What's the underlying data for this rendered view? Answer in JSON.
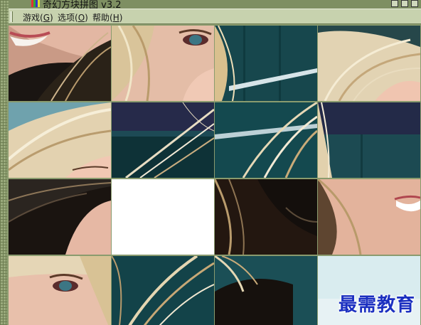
{
  "window": {
    "title": "奇幻方块拼图 v3.2"
  },
  "menu": {
    "items": [
      {
        "label": "游戏(",
        "hotkey": "G",
        "close": ")"
      },
      {
        "label": "选项(",
        "hotkey": "O",
        "close": ")"
      },
      {
        "label": "帮助(",
        "hotkey": "H",
        "close": ")"
      }
    ]
  },
  "puzzle": {
    "columns": 4,
    "rows": 4,
    "empty_slot": "row 3, column 2"
  },
  "watermark": {
    "text": "最需教育"
  },
  "colors": {
    "frame": "#8a9b6e",
    "menubar": "#c7d2ae",
    "watermark": "#1b2fc0"
  }
}
